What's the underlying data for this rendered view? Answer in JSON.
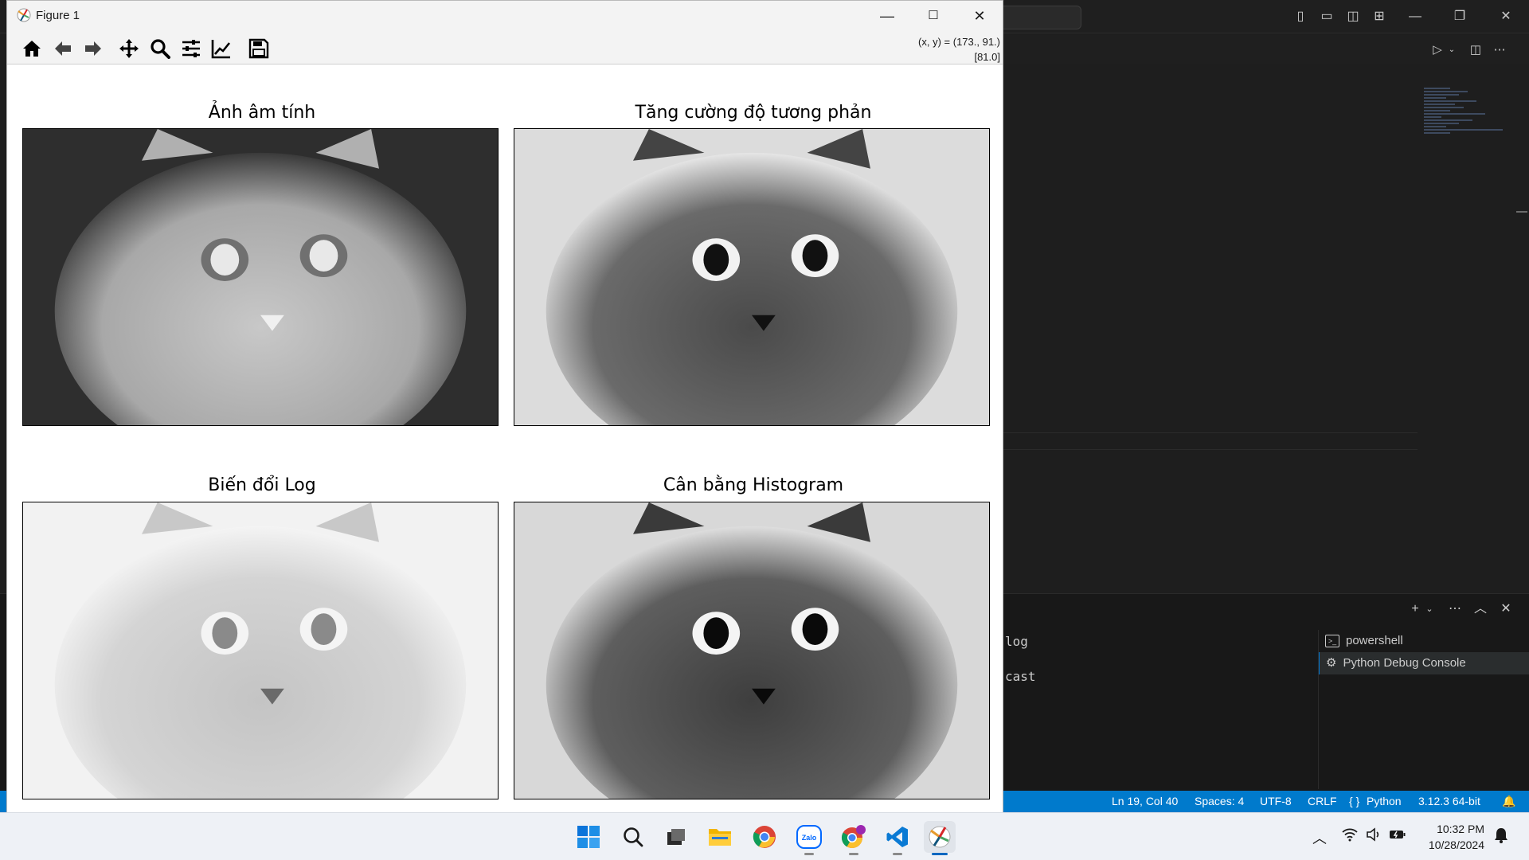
{
  "window": {
    "title": "Figure 1",
    "controls": {
      "minimize": "—",
      "maximize": "☐",
      "close": "✕"
    }
  },
  "toolbar": {
    "tools": [
      {
        "name": "home-icon"
      },
      {
        "name": "back-arrow-icon"
      },
      {
        "name": "forward-arrow-icon"
      },
      {
        "name": "pan-icon"
      },
      {
        "name": "zoom-icon"
      },
      {
        "name": "configure-subplots-icon"
      },
      {
        "name": "edit-axis-icon"
      },
      {
        "name": "save-icon"
      }
    ],
    "coords_line1": "(x, y) = (173., 91.)",
    "coords_line2": "[81.0]"
  },
  "figure": {
    "subplots": [
      {
        "title": "Ảnh âm tính"
      },
      {
        "title": "Tăng cường độ tương phản"
      },
      {
        "title": "Biến đổi Log"
      },
      {
        "title": "Cân bằng Histogram"
      }
    ]
  },
  "vscode": {
    "terminal_lines": [
      "log",
      "cast"
    ],
    "terminals": [
      {
        "label": "powershell",
        "icon": "terminal-icon"
      },
      {
        "label": "Python Debug Console",
        "icon": "debug-icon"
      }
    ],
    "statusbar": {
      "position": "Ln 19, Col 40",
      "spaces": "Spaces: 4",
      "encoding": "UTF-8",
      "eol": "CRLF",
      "language": "Python",
      "interpreter": "3.12.3 64-bit"
    }
  },
  "taskbar": {
    "apps": [
      "start-icon",
      "search-icon",
      "task-view-icon",
      "file-explorer-icon",
      "chrome-icon",
      "zalo-icon",
      "chrome-profile-icon",
      "vscode-icon",
      "matplotlib-icon"
    ],
    "zalo_label": "Zalo",
    "time": "10:32 PM",
    "date": "10/28/2024"
  },
  "colors": {
    "accent": "#007acc",
    "taskbar_active": "#0067c0"
  }
}
